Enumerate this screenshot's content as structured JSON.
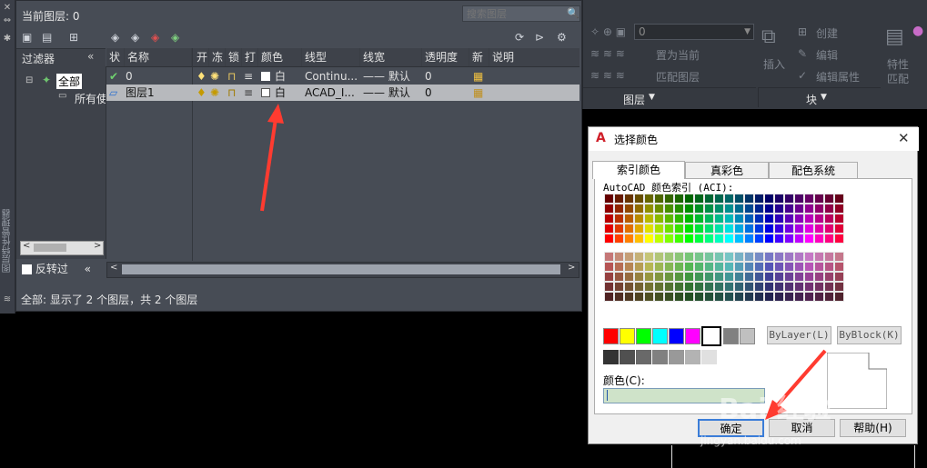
{
  "left_strip": {
    "vertical_text": "图层特性管理器"
  },
  "layer_manager": {
    "title": "当前图层: 0",
    "search_placeholder": "搜索图层",
    "filter_header": "过滤器",
    "filter_collapse": "«",
    "tree": {
      "root": "全部",
      "child": "所有使"
    },
    "reverse_filter": "反转过",
    "reverse_collapse": "«",
    "columns": [
      "状",
      "名称",
      "开",
      "冻",
      "锁",
      "打",
      "颜色",
      "线型",
      "线宽",
      "透明度",
      "新",
      "说明"
    ],
    "rows": [
      {
        "name": "0",
        "color": "白",
        "linetype": "Continu...",
        "lineweight": "—— 默认",
        "transparency": "0",
        "selected": false
      },
      {
        "name": "图层1",
        "color": "白",
        "linetype": "ACAD_I...",
        "lineweight": "—— 默认",
        "transparency": "0",
        "selected": true
      }
    ],
    "status": "全部: 显示了 2 个图层，共 2 个图层"
  },
  "ribbon": {
    "combo_value": "0",
    "items": [
      "创建",
      "编辑",
      "编辑属性",
      "置为当前",
      "匹配图层",
      "插入",
      "特性",
      "匹配"
    ],
    "group_layer": "图层",
    "group_block": "块"
  },
  "dialog": {
    "title": "选择颜色",
    "tabs": [
      "索引颜色",
      "真彩色",
      "配色系统"
    ],
    "aci_label": "AutoCAD 颜色索引 (ACI):",
    "bylayer": "ByLayer(L)",
    "byblock": "ByBlock(K)",
    "color_label": "颜色(C):",
    "ok": "确定",
    "cancel": "取消",
    "help": "帮助(H)",
    "standard_colors": [
      "#ff0000",
      "#ffff00",
      "#00ff00",
      "#00ffff",
      "#0000ff",
      "#ff00ff",
      "#ffffff",
      "#808080",
      "#c0c0c0"
    ],
    "gray_colors": [
      "#333333",
      "#505050",
      "#696969",
      "#808080",
      "#999999",
      "#b3b3b3",
      "#e0e0e0"
    ]
  },
  "watermark": {
    "main": "Bai 经验",
    "sub": "jingyan.baidu.com"
  },
  "colors": {
    "accent": "#ff3b30",
    "dialog_bg": "#f0f0f0",
    "panel_bg": "#474c55"
  }
}
